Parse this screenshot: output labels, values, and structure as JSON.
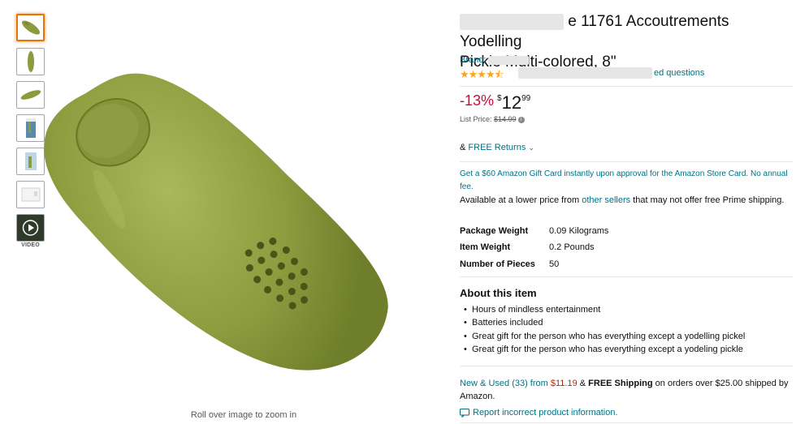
{
  "thumbnails": [
    {
      "name": "thumb-1",
      "kind": "image",
      "selected": true
    },
    {
      "name": "thumb-2",
      "kind": "image"
    },
    {
      "name": "thumb-3",
      "kind": "image"
    },
    {
      "name": "thumb-4",
      "kind": "image"
    },
    {
      "name": "thumb-5",
      "kind": "image"
    },
    {
      "name": "thumb-6",
      "kind": "image"
    },
    {
      "name": "thumb-video",
      "kind": "video",
      "label": "VIDEO"
    }
  ],
  "gallery": {
    "zoom_hint": "Roll over image to zoom in"
  },
  "product": {
    "title_part1": "e 11761 Accoutrements Yodelling",
    "title_part2": "Pickle Multi-colored, 8\"",
    "brand_label": "Brand: ",
    "rating_stars": "★★★★⯪",
    "answered_questions": "ed questions",
    "discount": "-13%",
    "price_symbol": "$",
    "price_whole": "12",
    "price_fraction": "99",
    "list_price_label": "List Price: ",
    "list_price": "$14.99",
    "returns_prefix": "& ",
    "returns_link": "FREE Returns",
    "gift_card_text": "Get a $60 Amazon Gift Card instantly upon approval for the Amazon Store Card. No annual fee.",
    "availability_prefix": "Available at a lower price from ",
    "availability_link": "other sellers",
    "availability_suffix": " that may not offer free Prime shipping."
  },
  "specs": [
    {
      "key": "Package Weight",
      "value": "0.09 Kilograms"
    },
    {
      "key": "Item Weight",
      "value": "0.2 Pounds"
    },
    {
      "key": "Number of Pieces",
      "value": "50"
    }
  ],
  "about": {
    "title": "About this item",
    "bullets": [
      "Hours of mindless entertainment",
      "Batteries included",
      "Great gift for the person who has everything except a yodelling pickel",
      "Great gift for the person who has everything except a yodeling pickle"
    ]
  },
  "offers": {
    "used_link": "New & Used (33) from ",
    "used_price": "$11.19",
    "amp": " & ",
    "free_shipping": "FREE Shipping",
    "shipping_suffix": " on orders over $25.00 shipped by Amazon."
  },
  "report": {
    "label": "Report incorrect product information."
  },
  "colors": {
    "link": "#007185",
    "discount": "#cc0c39",
    "star": "#ffa41c",
    "selected_thumb": "#e77600",
    "pickle": "#8a9a3a"
  }
}
